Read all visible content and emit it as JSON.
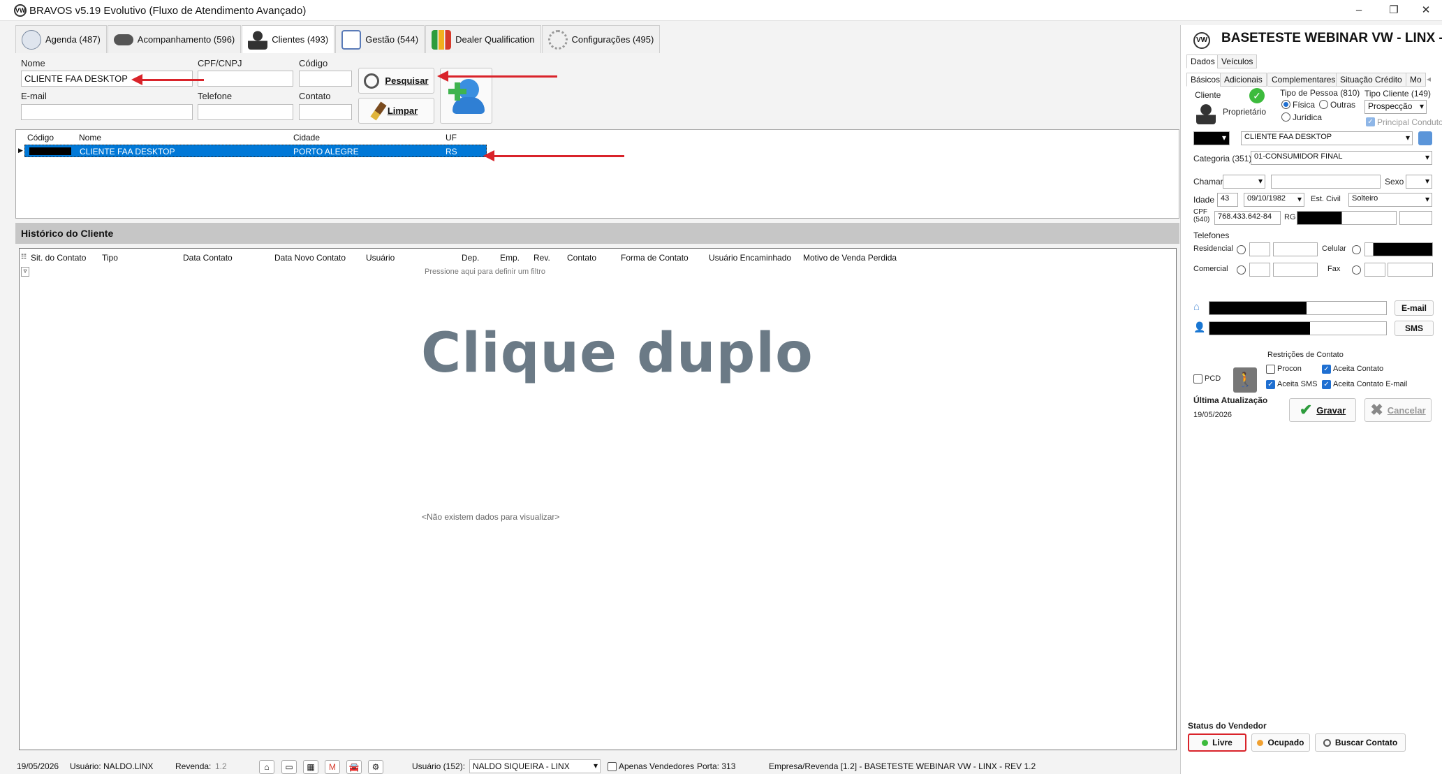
{
  "window": {
    "title": "BRAVOS v5.19 Evolutivo (Fluxo de Atendimento Avançado)",
    "minimize": "–",
    "restore": "❐",
    "close": "✕"
  },
  "tabs": [
    {
      "label": "Agenda (487)",
      "icon": "clock-icon",
      "color": "#7a8aa0"
    },
    {
      "label": "Acompanhamento (596)",
      "icon": "binoculars-icon",
      "color": "#444444"
    },
    {
      "label": "Clientes (493)",
      "icon": "person-icon",
      "color": "#333333"
    },
    {
      "label": "Gestão (544)",
      "icon": "report-icon",
      "color": "#5a7bb8"
    },
    {
      "label": "Dealer Qualification",
      "icon": "bar-chart-icon",
      "color": "#d63a2b"
    },
    {
      "label": "Configurações (495)",
      "icon": "gear-icon",
      "color": "#999999"
    }
  ],
  "search": {
    "nome_label": "Nome",
    "nome_value": "CLIENTE FAA DESKTOP",
    "cpf_label": "CPF/CNPJ",
    "cpf_value": "",
    "codigo_label": "Código",
    "codigo_value": "",
    "email_label": "E-mail",
    "email_value": "",
    "telefone_label": "Telefone",
    "telefone_value": "",
    "contato_label": "Contato",
    "contato_value": "",
    "pesquisar_label": "Pesquisar",
    "limpar_label": "Limpar"
  },
  "results": {
    "columns": [
      "Código",
      "Nome",
      "Cidade",
      "UF"
    ],
    "rows": [
      {
        "codigo": "",
        "nome": "CLIENTE FAA DESKTOP",
        "cidade": "PORTO ALEGRE",
        "uf": "RS"
      }
    ]
  },
  "history": {
    "title": "Histórico do Cliente",
    "columns": [
      "Sit. do Contato",
      "Tipo",
      "Data Contato",
      "Data Novo Contato",
      "Usuário",
      "Dep.",
      "Emp.",
      "Rev.",
      "Contato",
      "Forma de Contato",
      "Usuário Encaminhado",
      "Motivo de Venda Perdida"
    ],
    "filter_hint": "Pressione aqui para definir um filtro",
    "overlay_text": "Clique duplo",
    "empty_text": "<Não existem dados para visualizar>"
  },
  "statusbar": {
    "date": "19/05/2026",
    "usuario": "Usuário: NALDO.LINX",
    "revenda_label": "Revenda:",
    "revenda_value": "1.2",
    "usuario_count_label": "Usuário (152):",
    "usuario_select": "NALDO SIQUEIRA - LINX",
    "apenas_vendedores": "Apenas Vendedores",
    "porta": "Porta: 313",
    "empresa": "Empresa/Revenda [1.2] - BASETESTE WEBINAR VW - LINX - REV 1.2"
  },
  "panel": {
    "header": "BASETESTE WEBINAR VW - LINX - R",
    "tabs": [
      "Dados",
      "Veículos"
    ],
    "subtabs": [
      "Básicos",
      "Adicionais",
      "Complementares",
      "Situação Crédito",
      "Mo"
    ],
    "cliente_label": "Cliente",
    "proprietario_label": "Proprietário",
    "tipo_pessoa_label": "Tipo de Pessoa (810)",
    "fisica": "Física",
    "outras": "Outras",
    "juridica": "Jurídica",
    "tipo_cliente_label": "Tipo Cliente (149)",
    "tipo_cliente_value": "Prospecção",
    "principal_condutor": "Principal Condutor",
    "nome_value": "CLIENTE FAA DESKTOP",
    "categoria_label": "Categoria (351)",
    "categoria_value": "01-CONSUMIDOR FINAL",
    "chamar_label": "Chamar",
    "sexo_label": "Sexo",
    "idade_label": "Idade",
    "idade_value": "43",
    "nascimento_value": "09/10/1982",
    "est_civil_label": "Est. Civil",
    "est_civil_value": "Solteiro",
    "cpf_label": "CPF",
    "cpf_count": "(540)",
    "cpf_value": "768.433.642-84",
    "rg_label": "RG",
    "telefones_label": "Telefones",
    "residencial_label": "Residencial",
    "celular_label": "Celular",
    "comercial_label": "Comercial",
    "fax_label": "Fax",
    "email_btn": "E-mail",
    "sms_btn": "SMS",
    "restricoes_label": "Restrições de Contato",
    "pcd_label": "PCD",
    "procon_label": "Procon",
    "aceita_contato_label": "Aceita Contato",
    "aceita_sms_label": "Aceita SMS",
    "aceita_contato_email_label": "Aceita Contato E-mail",
    "ultima_atualizacao_label": "Última Atualização",
    "ultima_atualizacao_value": "19/05/2026",
    "gravar_label": "Gravar",
    "cancelar_label": "Cancelar",
    "status_title": "Status do Vendedor",
    "livre_label": "Livre",
    "ocupado_label": "Ocupado",
    "buscar_contato_label": "Buscar Contato",
    "livre_color": "#3dbb3d",
    "ocupado_color": "#f0a030"
  },
  "colors": {
    "selection": "#0078d7",
    "annotation_arrow": "#d9232a",
    "overlay_text": "#6b7a86"
  }
}
